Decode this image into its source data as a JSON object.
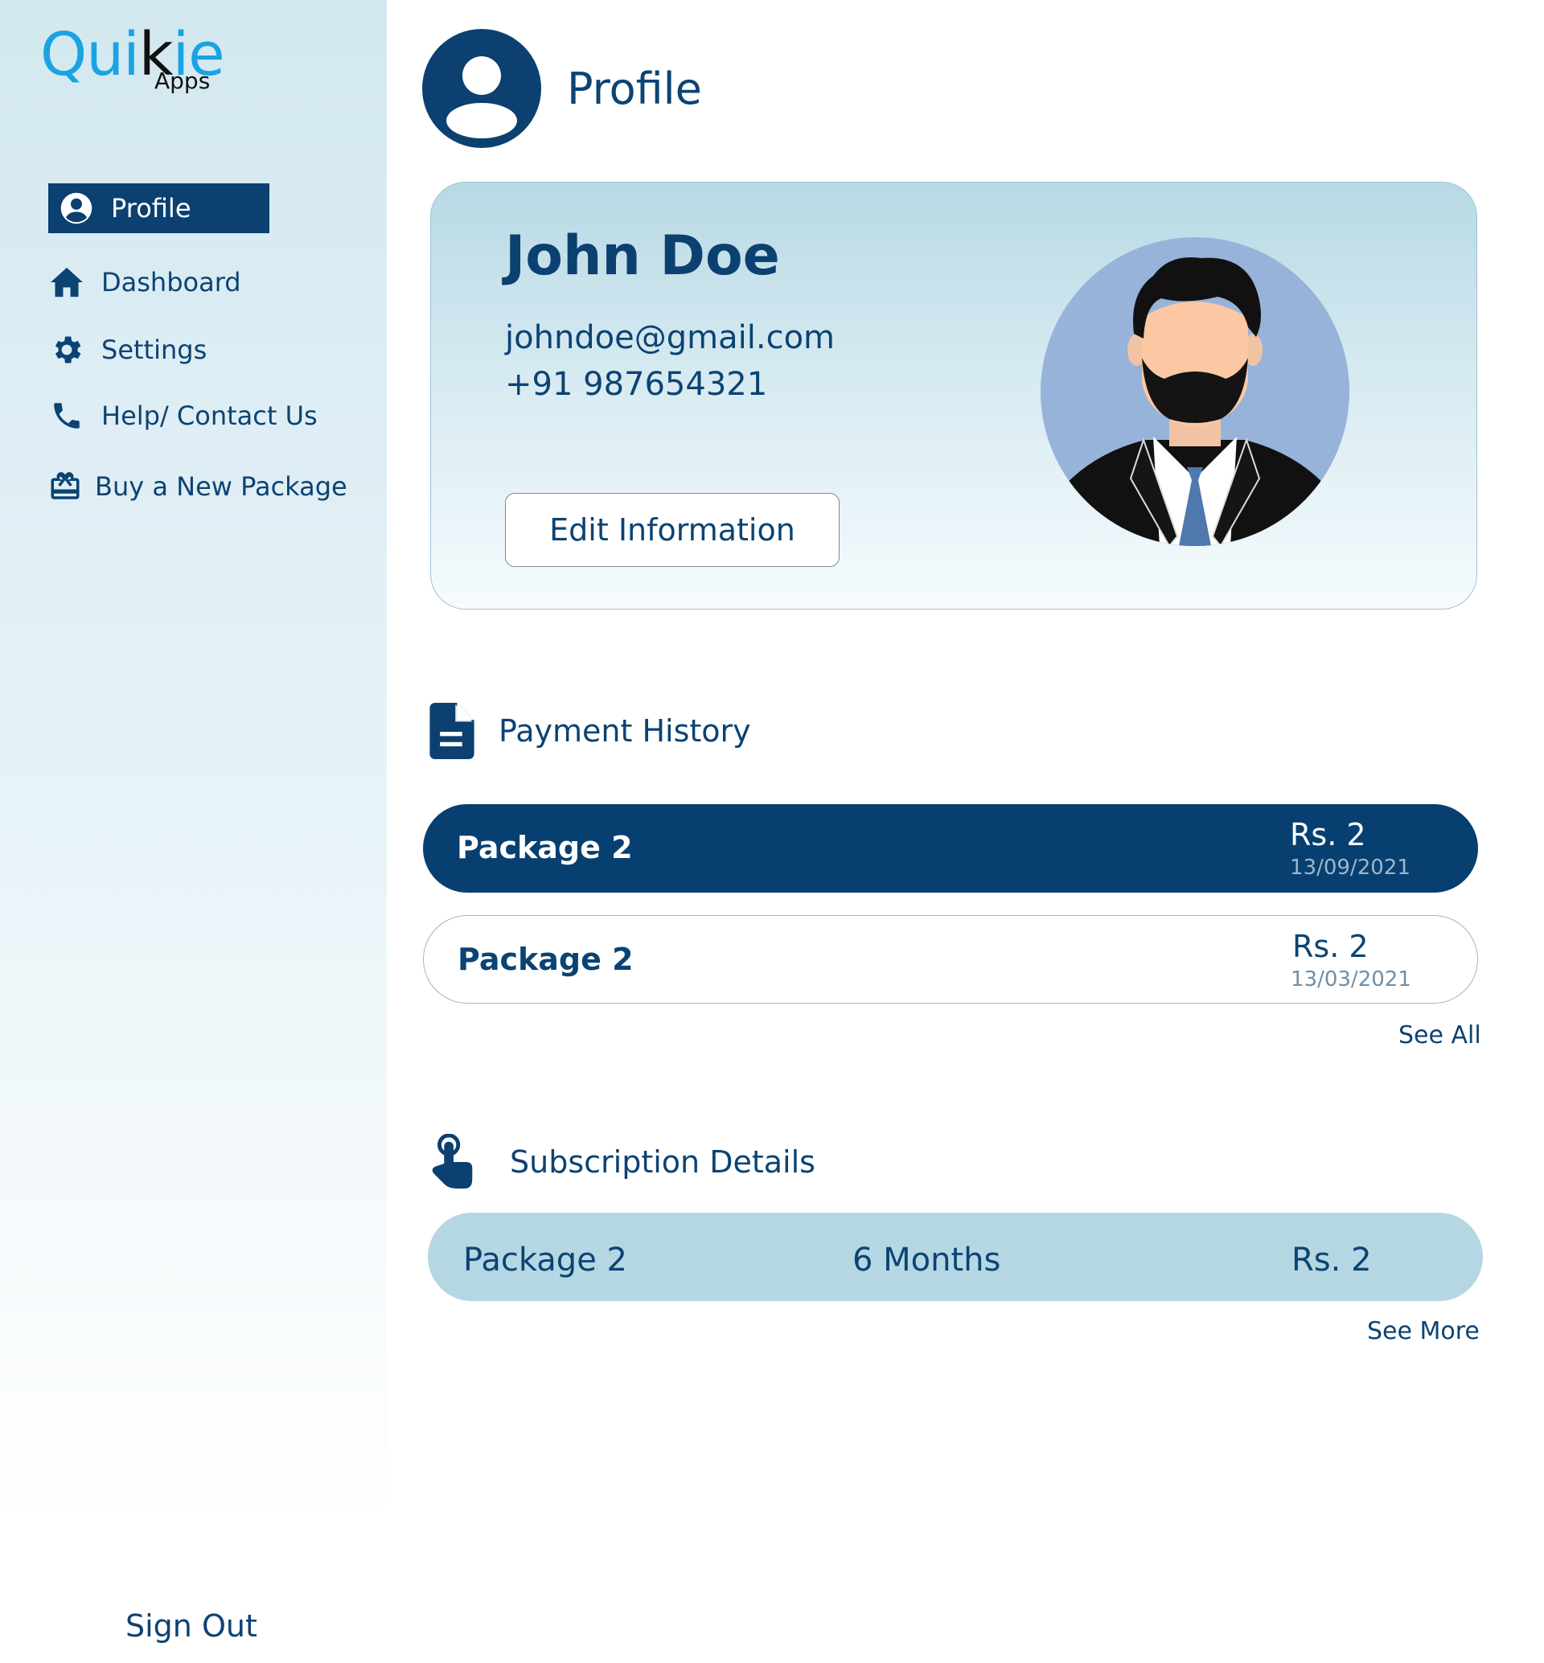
{
  "brand": {
    "logo_main_a": "Qui",
    "logo_main_b": "k",
    "logo_main_c": "ie",
    "logo_sub": "Apps",
    "accent": "#1aa3e3"
  },
  "sidebar": {
    "items": [
      {
        "label": "Profile",
        "icon": "account-circle-icon"
      },
      {
        "label": "Dashboard",
        "icon": "home-icon"
      },
      {
        "label": "Settings",
        "icon": "gear-icon"
      },
      {
        "label": "Help/ Contact Us",
        "icon": "phone-icon"
      },
      {
        "label": "Buy a New Package",
        "icon": "gift-card-icon"
      }
    ],
    "sign_out": "Sign Out"
  },
  "header": {
    "title": "Profile"
  },
  "profile": {
    "name": "John Doe",
    "email": "johndoe@gmail.com",
    "phone": "+91 987654321",
    "edit_label": "Edit Information"
  },
  "payment_history": {
    "title": "Payment History",
    "rows": [
      {
        "package": "Package 2",
        "amount": "Rs. 2",
        "date": "13/09/2021"
      },
      {
        "package": "Package 2",
        "amount": "Rs. 2",
        "date": "13/03/2021"
      }
    ],
    "see_all": "See All"
  },
  "subscription": {
    "title": "Subscription Details",
    "package": "Package 2",
    "duration": "6 Months",
    "amount": "Rs. 2",
    "see_more": "See More"
  },
  "colors": {
    "primary": "#0b4070",
    "sidebar_top": "#d3e8f0",
    "subscription_bg": "#b4d7e3"
  }
}
